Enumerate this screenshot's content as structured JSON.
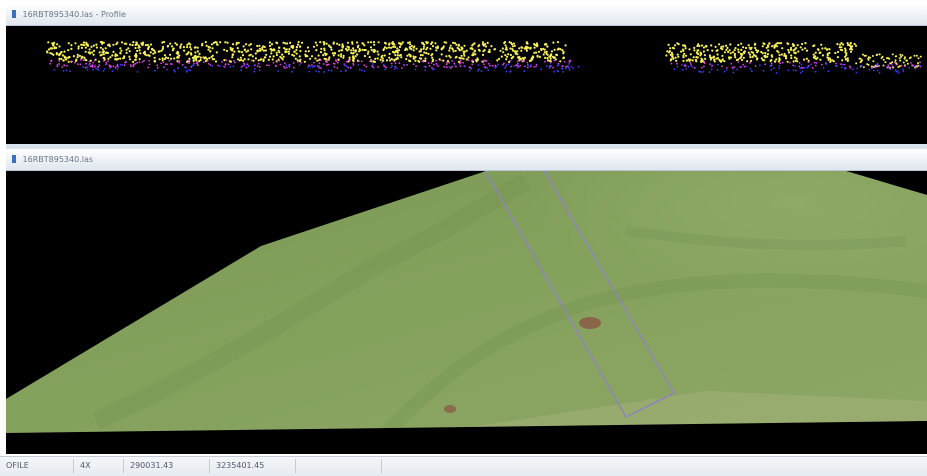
{
  "profile_window": {
    "title": "16RBT895340.las - Profile",
    "icon": "window-icon"
  },
  "scene_window": {
    "title": "16RBT895340.las",
    "icon": "window-icon"
  },
  "statusbar": {
    "mode": "OFILE",
    "zoom": "4X",
    "easting": "290031.43",
    "northing": "3235401.45",
    "extra": ""
  },
  "colors": {
    "canopy_points": "#f7f05a",
    "ground_points": "#e040e0",
    "low_points": "#3a3aff",
    "terrain_green": "#7f9d57",
    "profile_box": "#8f86b8"
  }
}
